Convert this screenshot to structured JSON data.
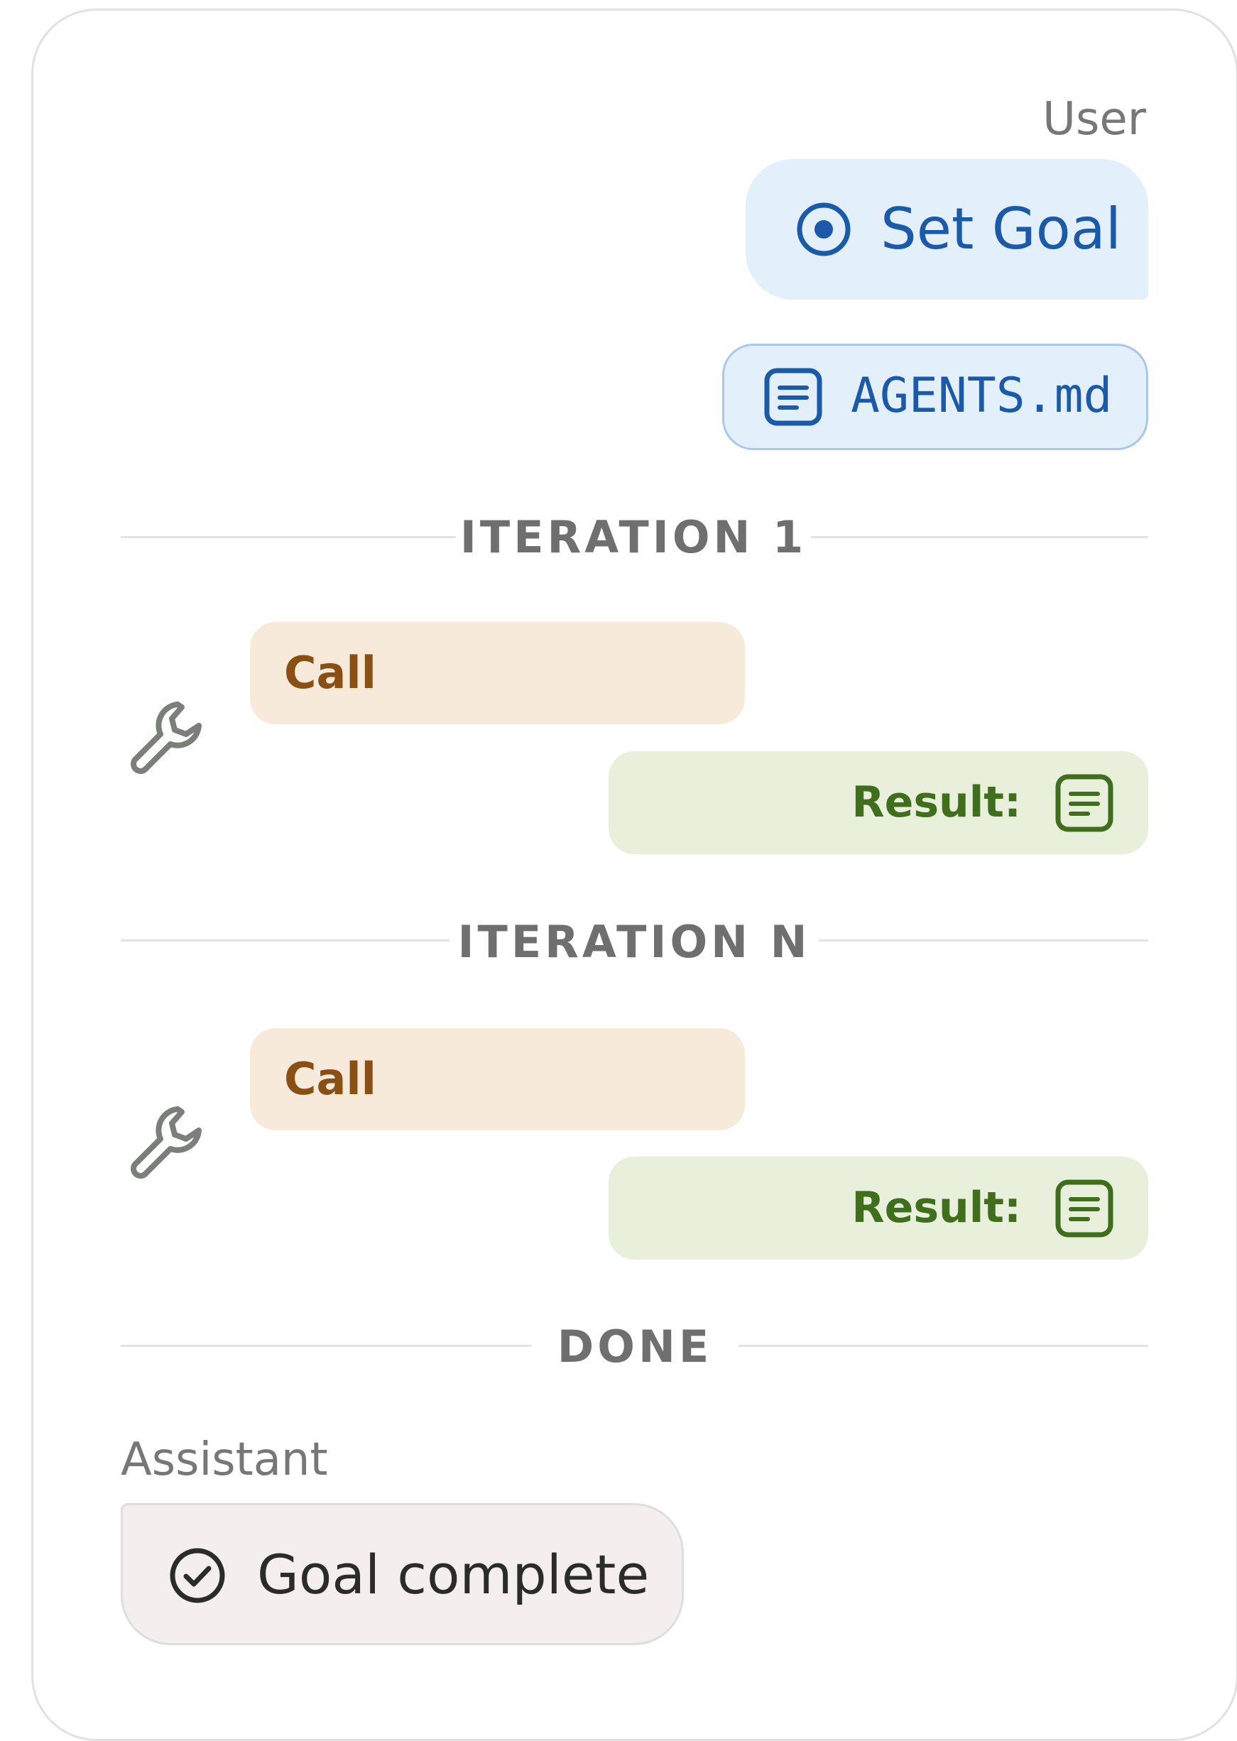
{
  "user": {
    "role_label": "User",
    "goal_label": "Set Goal",
    "file_label": "AGENTS.md"
  },
  "iterations": [
    {
      "title": "ITERATION 1",
      "call_label": "Call",
      "result_label": "Result:"
    },
    {
      "title": "ITERATION N",
      "call_label": "Call",
      "result_label": "Result:"
    }
  ],
  "done": {
    "title": "DONE"
  },
  "assistant": {
    "role_label": "Assistant",
    "message": "Goal complete"
  },
  "icons": {
    "goal": "target-icon",
    "file": "document-icon",
    "tool": "wrench-icon",
    "result": "document-icon",
    "complete": "check-circle-icon"
  },
  "colors": {
    "user_bubble": "#e3effb",
    "user_text": "#1a5aa8",
    "call_bubble": "#f7eadb",
    "call_text": "#8a4f12",
    "result_bubble": "#e8f0dc",
    "result_text": "#3f6e1c",
    "assistant_bubble": "#f4efee"
  }
}
